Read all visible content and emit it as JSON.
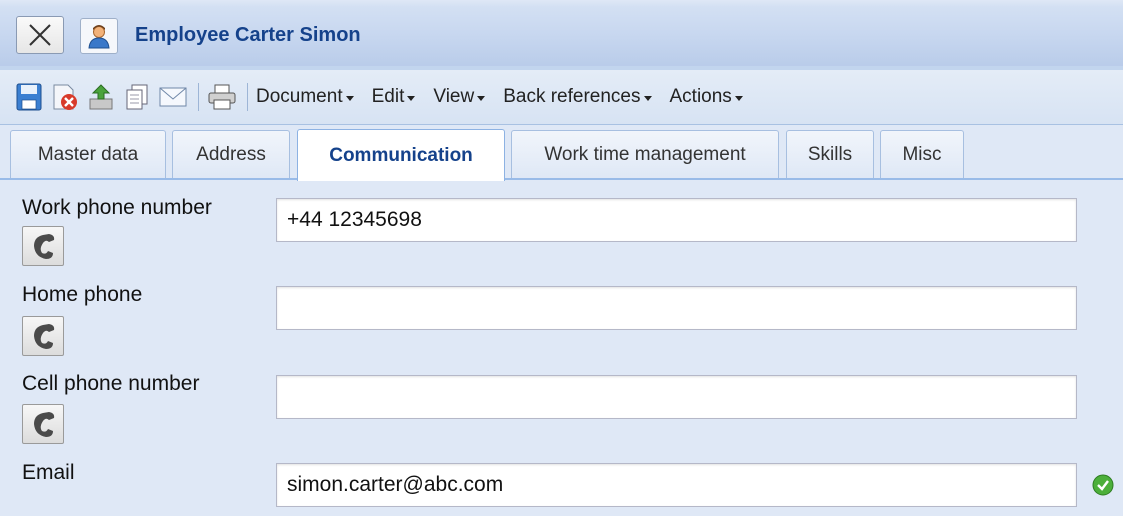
{
  "window": {
    "title": "Employee Carter Simon",
    "close_icon": "close-icon",
    "app_icon": "employee-person-icon"
  },
  "toolbar": {
    "icons": [
      "save-icon",
      "delete-icon",
      "upload-icon",
      "copy-icon",
      "email-icon",
      "print-icon"
    ],
    "menus": [
      {
        "label": "Document"
      },
      {
        "label": "Edit"
      },
      {
        "label": "View"
      },
      {
        "label": "Back references"
      },
      {
        "label": "Actions"
      }
    ]
  },
  "tabs": [
    {
      "label": "Master data",
      "active": false
    },
    {
      "label": "Address",
      "active": false
    },
    {
      "label": "Communication",
      "active": true
    },
    {
      "label": "Work time management",
      "active": false
    },
    {
      "label": "Skills",
      "active": false
    },
    {
      "label": "Misc",
      "active": false
    }
  ],
  "form": {
    "fields": [
      {
        "label": "Work phone number",
        "value": "+44 12345698",
        "has_phone_button": true
      },
      {
        "label": "Home phone",
        "value": "",
        "has_phone_button": true
      },
      {
        "label": "Cell phone number",
        "value": "",
        "has_phone_button": true
      },
      {
        "label": "Email",
        "value": "simon.carter@abc.com",
        "has_phone_button": false,
        "valid": true
      }
    ]
  },
  "colors": {
    "accent": "#15428b",
    "background": "#dfe8f6",
    "valid": "#3a9d2a"
  }
}
